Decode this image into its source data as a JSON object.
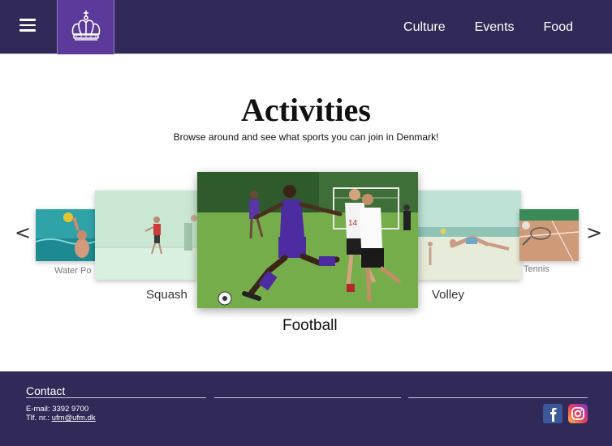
{
  "header": {
    "nav": [
      "Culture",
      "Events",
      "Food"
    ]
  },
  "main": {
    "title": "Activities",
    "subtitle": "Browse around and see what sports you can join in Denmark!",
    "carousel": [
      {
        "label": "Water Po",
        "image": "water-polo-photo"
      },
      {
        "label": "Squash",
        "image": "squash-photo"
      },
      {
        "label": "Football",
        "image": "football-photo"
      },
      {
        "label": "Volley",
        "image": "beach-volley-photo"
      },
      {
        "label": "Tennis",
        "image": "tennis-photo"
      }
    ],
    "prev_arrow": "<",
    "next_arrow": ">"
  },
  "footer": {
    "contact_title": "Contact",
    "email": "E-mail: 3392 9700",
    "phone_prefix": "Tlf. nr.: ",
    "phone_link": "ufm@ufm.dk"
  },
  "icons": {
    "menu": "hamburger-icon",
    "logo": "crown-logo",
    "facebook": "facebook-icon",
    "instagram": "instagram-icon"
  },
  "colors": {
    "header_bg": "#312a58",
    "logo_bg": "#5b3a9a",
    "footer_bg": "#312a58"
  }
}
